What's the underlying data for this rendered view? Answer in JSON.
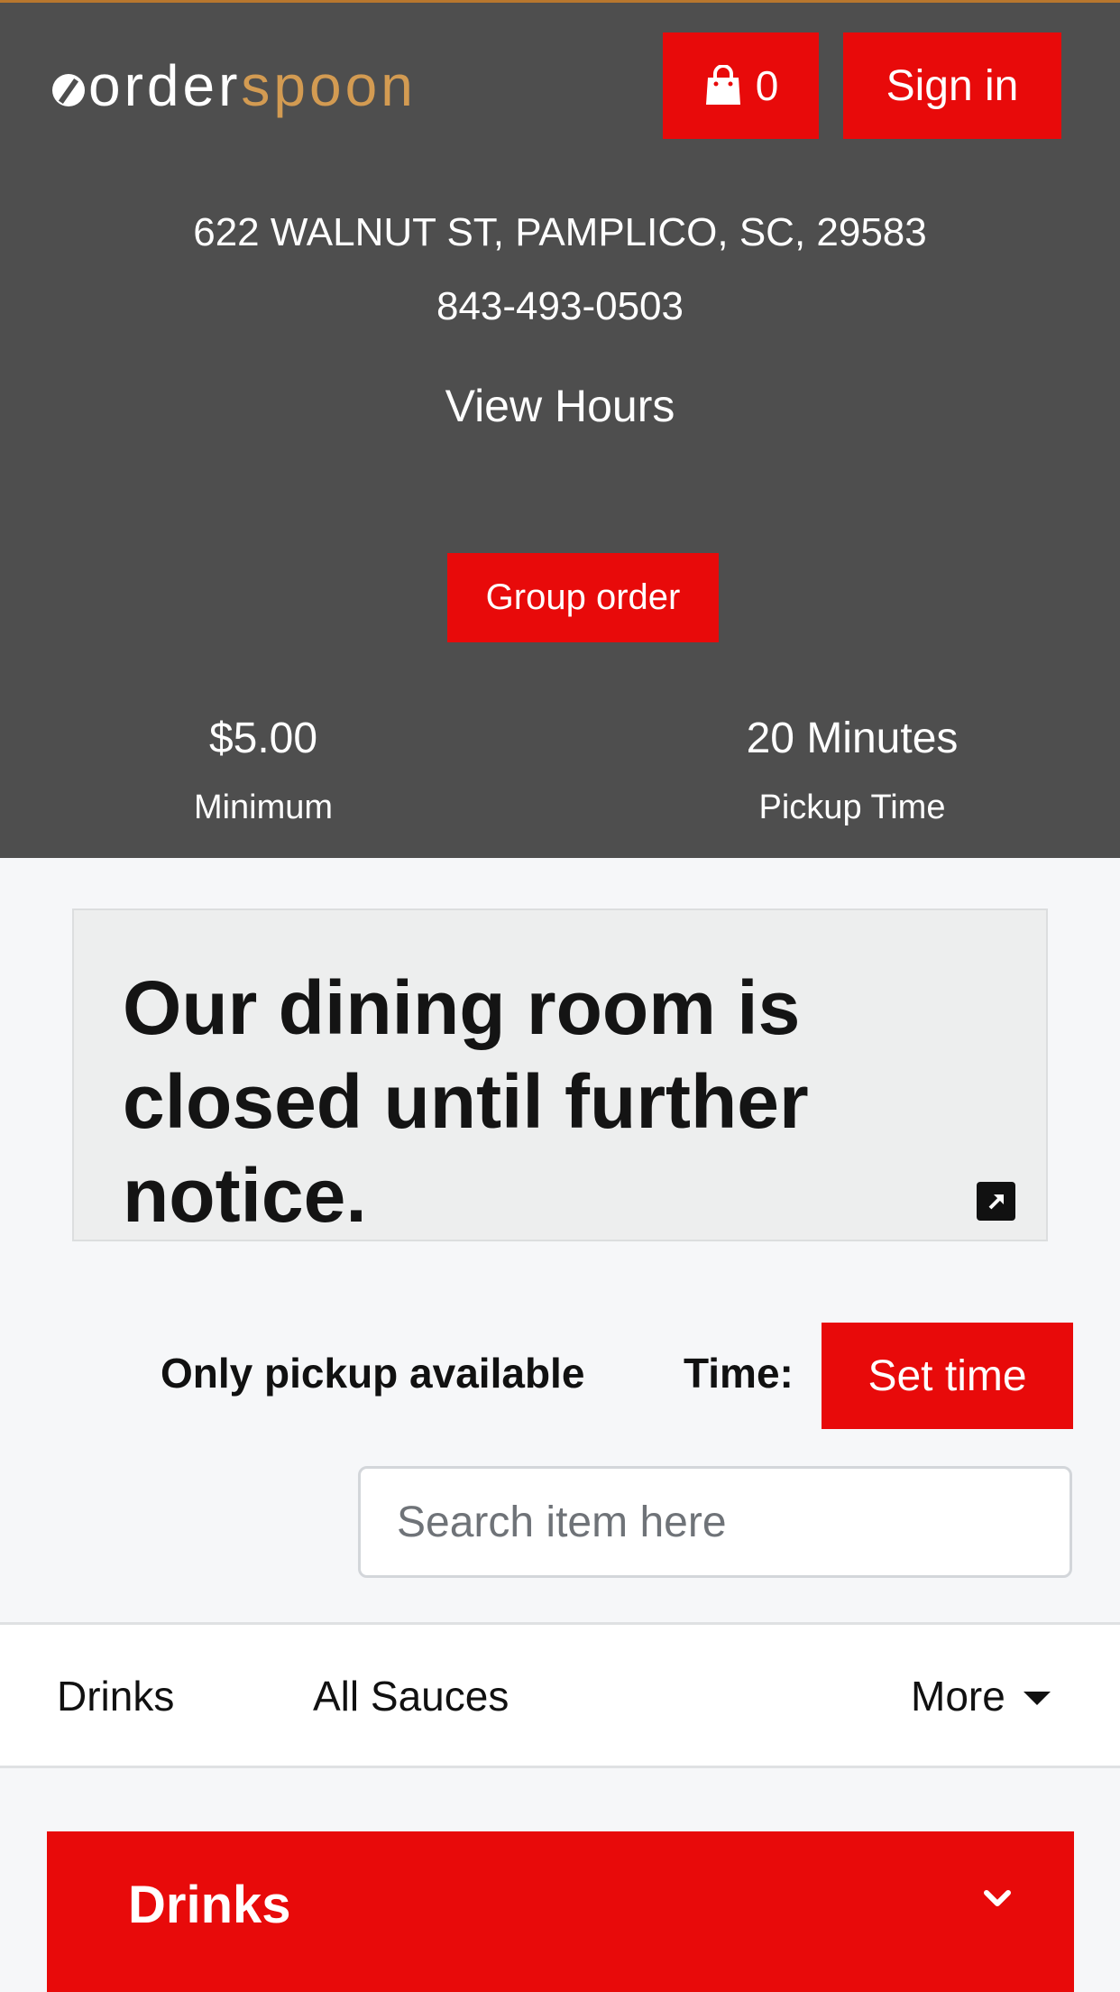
{
  "header": {
    "logo_order": "order",
    "logo_spoon": "spoon",
    "cart_count": "0",
    "sign_in_label": "Sign in"
  },
  "restaurant": {
    "address": "622 WALNUT ST, PAMPLICO, SC, 29583",
    "phone": "843-493-0503",
    "hours_link": "View Hours",
    "group_order_label": "Group order",
    "minimum_value": "$5.00",
    "minimum_label": "Minimum",
    "pickup_time_value": "20 Minutes",
    "pickup_time_label": "Pickup Time"
  },
  "notice": {
    "text": "Our dining room is closed until further notice."
  },
  "ordering": {
    "pickup_text": "Only pickup available",
    "time_label": "Time:",
    "set_time_label": "Set time",
    "search_placeholder": "Search item here"
  },
  "categories": {
    "items": [
      "Drinks",
      "All Sauces"
    ],
    "more_label": "More"
  },
  "section": {
    "title": "Drinks"
  },
  "colors": {
    "accent_red": "#e80a0a",
    "hero_bg": "#4e4e4e",
    "logo_gold": "#d39b52"
  }
}
